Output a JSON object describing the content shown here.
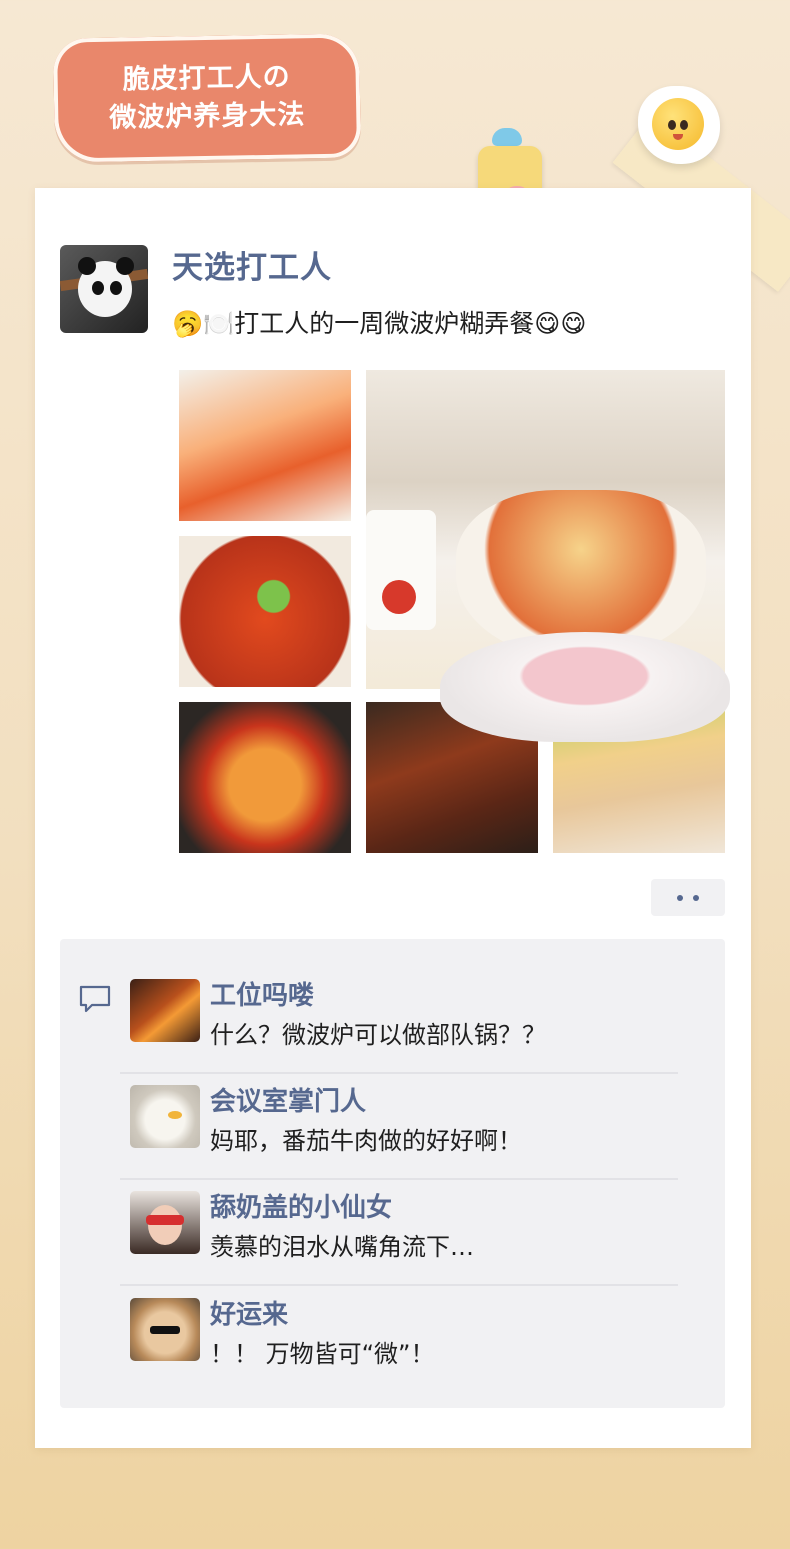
{
  "header": {
    "title_line1": "脆皮打工人の",
    "title_line2": "微波炉养身大法"
  },
  "post": {
    "author": "天选打工人",
    "text": "🥱🍽️打工人的一周微波炉糊弄餐😋😋",
    "photos": [
      {
        "subject": "shrimp"
      },
      {
        "subject": "mapo-tofu"
      },
      {
        "subject": "beef-potato-stew"
      },
      {
        "subject": "microwave-cheese-hotpot"
      },
      {
        "subject": "glazed-wings"
      },
      {
        "subject": "cold-noodle-salad"
      }
    ]
  },
  "comments": [
    {
      "name": "工位吗喽",
      "text": "什么？微波炉可以做部队锅？？"
    },
    {
      "name": "会议室掌门人",
      "text": "妈耶，番茄牛肉做的好好啊！"
    },
    {
      "name": "舔奶盖的小仙女",
      "text": "羡慕的泪水从嘴角流下…"
    },
    {
      "name": "好运来",
      "text": "！！ 万物皆可“微”！"
    }
  ],
  "colors": {
    "accent_name": "#56688f",
    "title_bg": "#e9876b",
    "comment_bg": "#f1f1f3"
  }
}
